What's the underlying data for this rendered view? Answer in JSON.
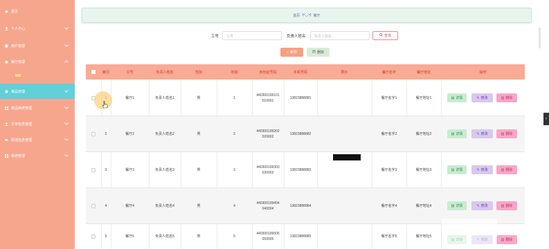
{
  "sidebar": {
    "items": [
      {
        "label": "首页",
        "icon": "home-icon",
        "expandable": false
      },
      {
        "label": "个人中心",
        "icon": "user-icon",
        "expandable": true
      },
      {
        "label": "用户管理",
        "icon": "users-icon",
        "expandable": true
      },
      {
        "label": "餐厅管理",
        "icon": "building-icon",
        "expandable": true,
        "expanded": true
      },
      {
        "label": "菜品管理",
        "icon": "dish-icon",
        "expandable": true,
        "active": true
      },
      {
        "label": "菜品种类管理",
        "icon": "grid-icon",
        "expandable": true
      },
      {
        "label": "订单信息管理",
        "icon": "order-icon",
        "expandable": true
      },
      {
        "label": "配送信息管理",
        "icon": "truck-icon",
        "expandable": true
      },
      {
        "label": "系统管理",
        "icon": "settings-icon",
        "expandable": true
      }
    ],
    "colors": {
      "background": "#f7a68e",
      "active": "#63cfd9"
    }
  },
  "header": {
    "breadcrumb_home": "首页",
    "face": "(•'◡'•)",
    "breadcrumb_current": "餐厅"
  },
  "search": {
    "worker_id_label": "工号",
    "worker_id_placeholder": "工号",
    "manager_label": "负责人姓名",
    "manager_placeholder": "负责人姓名",
    "search_button": "查询"
  },
  "toolbar": {
    "add_button": "新增",
    "delete_button": "删除"
  },
  "table": {
    "columns": [
      "索引",
      "工号",
      "负责人姓名",
      "性别",
      "年龄",
      "身份证号码",
      "手机号码",
      "照片",
      "餐厅名字",
      "餐厅地址",
      "操作"
    ],
    "rows": [
      {
        "index": "1",
        "worker_id": "餐厅1",
        "manager": "负责人姓名1",
        "gender": "男",
        "age": "1",
        "id_line1": "440300199101",
        "id_line2": "010001",
        "phone": "13823888881",
        "name": "餐厅名字1",
        "address": "餐厅地址1"
      },
      {
        "index": "2",
        "worker_id": "餐厅2",
        "manager": "负责人姓名2",
        "gender": "男",
        "age": "2",
        "id_line1": "440300199202",
        "id_line2": "020002",
        "phone": "13823888882",
        "name": "餐厅名字2",
        "address": "餐厅地址2"
      },
      {
        "index": "3",
        "worker_id": "餐厅3",
        "manager": "负责人姓名3",
        "gender": "男",
        "age": "3",
        "id_line1": "440300199303",
        "id_line2": "030003",
        "phone": "13823888883",
        "name": "餐厅名字3",
        "address": "餐厅地址3"
      },
      {
        "index": "4",
        "worker_id": "餐厅4",
        "manager": "负责人姓名4",
        "gender": "男",
        "age": "4",
        "id_line1": "440300199404",
        "id_line2": "040004",
        "phone": "13823888884",
        "name": "餐厅名字4",
        "address": "餐厅地址4"
      },
      {
        "index": "5",
        "worker_id": "餐厅5",
        "manager": "负责人姓名5",
        "gender": "男",
        "age": "5",
        "id_line1": "440300199505",
        "id_line2": "050005",
        "phone": "13823888885",
        "name": "餐厅名字5",
        "address": "餐厅地址5"
      }
    ],
    "actions": {
      "detail": "详情",
      "edit": "修改",
      "remove": "删除"
    }
  },
  "colors": {
    "header_row": "#f9ab93",
    "header_text": "#c03a2b",
    "add_button": "#f89f80",
    "detail_button": "#c8ecd0",
    "edit_button": "#d8c8ef",
    "delete_button": "#f7a7c8"
  }
}
